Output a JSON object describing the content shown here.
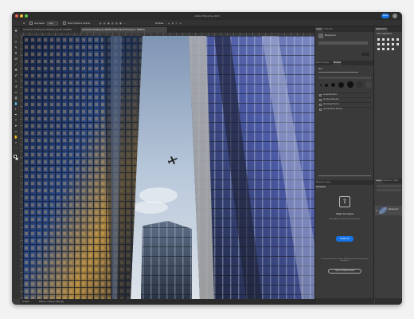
{
  "window": {
    "title": "Adobe Photoshop 2023",
    "share_label": "Share"
  },
  "options_bar": {
    "items": [
      "Auto-Select:",
      "Layer",
      "Show Transform Controls"
    ],
    "mode": "3D Mode:"
  },
  "tabs": [
    {
      "label": "Architecture-building-city-408148.jpg @ 50% (RGB/8#)",
      "active": false
    },
    {
      "label": "Architecture-building-city-408148-4-Edit.tif @ 33.3% (Layer 0, RGB/16)",
      "active": true
    }
  ],
  "status_bar": {
    "zoom": "33.33%",
    "info": "6000 px x 4000 px (300 ppi)"
  },
  "panels": {
    "top_left": {
      "tabs": [
        "Layers",
        "Channels"
      ],
      "row_label": "Background"
    },
    "brush_settings": {
      "tabs": [
        "Brush Settings",
        "Brushes"
      ],
      "size_label": "Size:",
      "presets": [
        "General Brushes",
        "Dry Media Brushes",
        "Wet Media Brushes",
        "Special Effects Brushes"
      ]
    },
    "properties": {
      "tabs": [
        "Adjustments",
        "Libraries"
      ],
      "title": "Layer Properties"
    },
    "share": {
      "tabs": [
        "Share for review",
        "Comments"
      ],
      "heading": "Share for review",
      "description": "Get feedback on your work from anyone.",
      "button": "Create link",
      "footer_text": "To use our review in Creative Cloud, you'll need to upgrade to cloud docs.",
      "footer_button": "Save to Creative Cloud"
    },
    "layers": {
      "tabs": [
        "Layers",
        "Channels",
        "Paths"
      ],
      "layer_name": "Background"
    },
    "history": {
      "tabs": [
        "History",
        "Actions"
      ]
    },
    "swatches": {
      "tabs": [
        "Adjustments"
      ],
      "title": "Add an adjustment"
    }
  },
  "tools": [
    "move-icon",
    "marquee-icon",
    "lasso-icon",
    "quick-select-icon",
    "crop-icon",
    "frame-icon",
    "eyedropper-icon",
    "healing-icon",
    "brush-icon",
    "clone-stamp-icon",
    "history-brush-icon",
    "eraser-icon",
    "gradient-icon",
    "blur-icon",
    "dodge-icon",
    "pen-icon",
    "type-icon",
    "path-select-icon",
    "rectangle-icon",
    "hand-icon",
    "zoom-icon",
    "more-icon"
  ],
  "colors": {
    "accent": "#1473e6",
    "foreground": "#000000",
    "background": "#ffffff"
  }
}
